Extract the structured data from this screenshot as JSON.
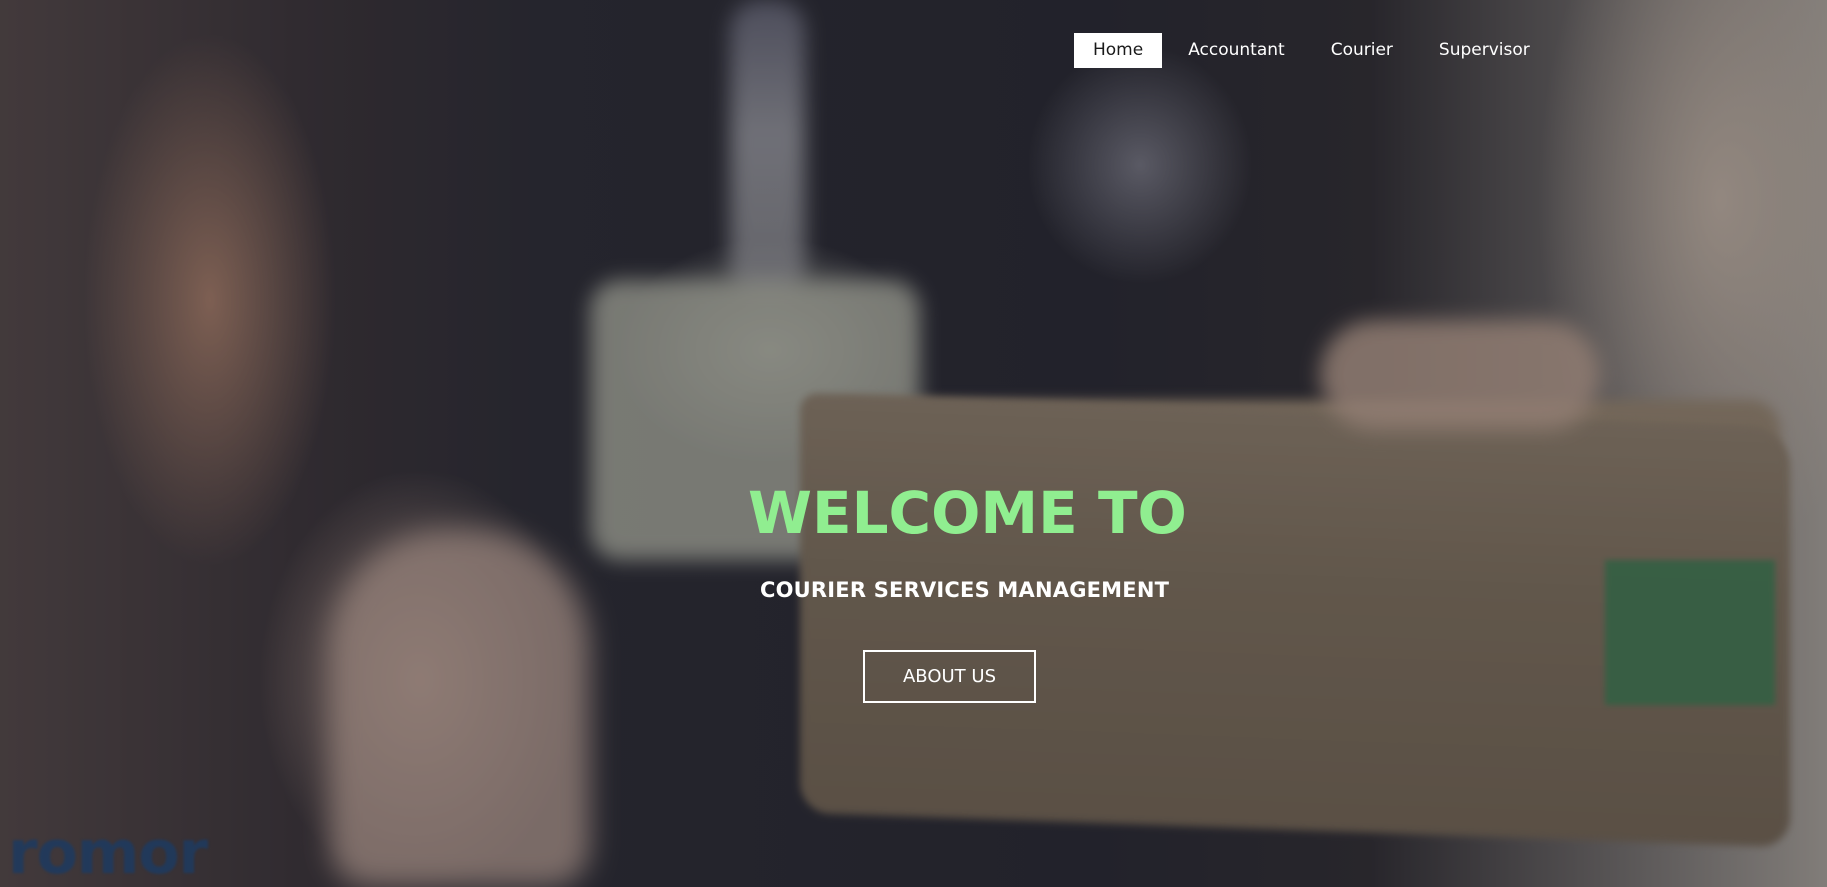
{
  "nav": {
    "items": [
      {
        "label": "Home",
        "active": true
      },
      {
        "label": "Accountant",
        "active": false
      },
      {
        "label": "Courier",
        "active": false
      },
      {
        "label": "Supervisor",
        "active": false
      }
    ]
  },
  "hero": {
    "title": "WELCOME TO",
    "subtitle": "COURIER SERVICES MANAGEMENT",
    "button_label": "ABOUT US",
    "title_color": "#90ee90"
  },
  "background": {
    "logo_text": "romor"
  }
}
